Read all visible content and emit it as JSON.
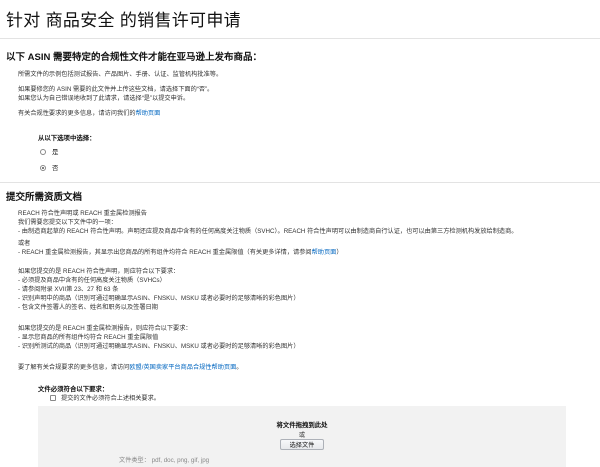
{
  "page": {
    "title": "针对 商品安全 的销售许可申请"
  },
  "section1": {
    "heading": "以下 ASIN 需要特定的合规性文件才能在亚马逊上发布商品：",
    "line1": "所需文件的示例包括测试报告、产品图片、手册、认证、监管机构批准等。",
    "line2": "如果要修您的 ASIN 需要的此文件并上传这些文档，请选择下面的“否”。",
    "line3": "如果您认为自己错误地收到了此请求，请选择“是”以提交申诉。",
    "line4_prefix": "有关合规性要求的更多信息，请访问我们的",
    "line4_link": "帮助页面",
    "question": "从以下选项中选择：",
    "options": [
      {
        "label": "是",
        "checked": false
      },
      {
        "label": "否",
        "checked": true
      }
    ]
  },
  "section2": {
    "heading": "提交所需资质文档",
    "lines": [
      "REACH 符合性声明或 REACH 重金属检测报告",
      "我们需要您提交以下文件中的一项：",
      "- 由制造商起草的 REACH 符合性声明。声明还应提及商品中含有的任何高度关注物质（SVHC）。REACH 符合性声明可以由制造商自行认证，也可以由第三方检测机构发放给制造商。",
      "或者",
      "- REACH 重金属检测报告，其显示出您商品的所有组件均符合 REACH 重金属限值（有关更多详情，请参阅"
    ],
    "lines_link": "帮助页面",
    "lines_suffix": "）",
    "decl_lines": [
      "如果您提交的是 REACH 符合性声明，则应符合以下要求：",
      "- 必须提及商品中含有的任何高度关注物质（SVHCs）",
      "- 请参阅附录 XVII第 23、27 和 63 条",
      "- 识别声明中的商品（识别可通过明确显示ASIN、FNSKU、MSKU 或者必要时的足够清晰的彩色图片）",
      "- 包含文件签署人的签名、姓名和职务以及签署日期"
    ],
    "test_lines": [
      "如果您提交的是 REACH 重金属检测报告，则应符合以下要求：",
      "- 显示您商品的所有组件均符合 REACH 重金属限值",
      "- 识别所测试的商品（识别可通过明确显示ASIN、FNSKU、MSKU 或者必要时的足够清晰的彩色图片）"
    ],
    "more_prefix": "要了解有关合规要求的更多信息，请访问",
    "more_link": "欧盟/英国卖家平台商品合规性帮助页面",
    "more_suffix": "。"
  },
  "upload": {
    "requirements_label": "文件必须符合以下要求：",
    "checkbox_label": "提交的文件必须符合上述相关要求。",
    "drop_title": "将文件拖拽到此处",
    "or_text": "或",
    "choose_button": "选择文件",
    "file_types": "文件类型： pdf, doc, png, gif, jpg"
  }
}
